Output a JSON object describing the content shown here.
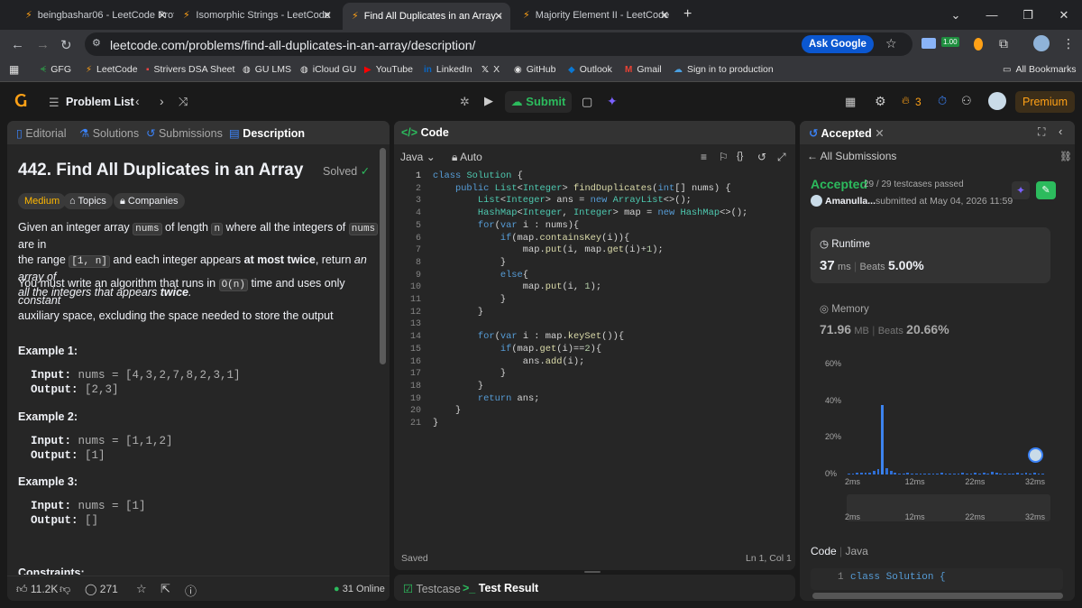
{
  "browser": {
    "tabs": [
      {
        "title": "beingbashar06 - LeetCode Profi",
        "active": false
      },
      {
        "title": "Isomorphic Strings - LeetCode",
        "active": false
      },
      {
        "title": "Find All Duplicates in an Array -",
        "active": true
      },
      {
        "title": "Majority Element II - LeetCode",
        "active": false
      }
    ],
    "url": "leetcode.com/problems/find-all-duplicates-in-an-array/description/",
    "ask_google": "Ask Google",
    "extension_badge": "1.00",
    "bookmarks": [
      "GFG",
      "LeetCode",
      "Strivers DSA Sheet",
      "GU LMS",
      "iCloud GU",
      "YouTube",
      "LinkedIn",
      "X",
      "GitHub",
      "Outlook",
      "Gmail",
      "Sign in to production"
    ],
    "all_bookmarks": "All Bookmarks"
  },
  "nav": {
    "problem_list": "Problem List",
    "submit": "Submit",
    "streak": "3",
    "premium": "Premium"
  },
  "left": {
    "tabs": [
      "Editorial",
      "Solutions",
      "Submissions",
      "Description"
    ],
    "title": "442. Find All Duplicates in an Array",
    "solved": "Solved",
    "difficulty": "Medium",
    "topics": "Topics",
    "companies": "Companies",
    "desc": {
      "p1_a": "Given an integer array ",
      "p1_code1": "nums",
      "p1_b": " of length ",
      "p1_code2": "n",
      "p1_c": " where all the integers of ",
      "p1_code3": "nums",
      "p1_d": " are in",
      "p1_e": "the range ",
      "p1_code4": "[1, n]",
      "p1_f": " and each integer appears ",
      "p1_bold1": "at most twice",
      "p1_g": ", return ",
      "p1_it1": "an array of",
      "p1_it2": "all the integers that appears ",
      "p1_bolditalic": "twice",
      "p1_h": ".",
      "p2_a": "You must write an algorithm that runs in ",
      "p2_code": "O(n)",
      "p2_b": " time and uses only ",
      "p2_it": "constant",
      "p2_c": "auxiliary space, excluding the space needed to store the output"
    },
    "examples": [
      {
        "title": "Example 1:",
        "input": "nums = [4,3,2,7,8,2,3,1]",
        "output": "[2,3]"
      },
      {
        "title": "Example 2:",
        "input": "nums = [1,1,2]",
        "output": "[1]"
      },
      {
        "title": "Example 3:",
        "input": "nums = [1]",
        "output": "[]"
      }
    ],
    "input_label": "Input:",
    "output_label": "Output:",
    "constraints": "Constraints:",
    "likes": "11.2K",
    "comments": "271",
    "online": "31 Online"
  },
  "code": {
    "header": "Code",
    "language": "Java",
    "auto": "Auto",
    "saved": "Saved",
    "cursor": "Ln 1, Col 1",
    "lines": [
      "class Solution {",
      "    public List<Integer> findDuplicates(int[] nums) {",
      "        List<Integer> ans = new ArrayList<>();",
      "        HashMap<Integer, Integer> map = new HashMap<>();",
      "        for(var i : nums){",
      "            if(map.containsKey(i)){",
      "                map.put(i, map.get(i)+1);",
      "            }",
      "            else{",
      "                map.put(i, 1);",
      "            }",
      "        }",
      "",
      "        for(var i : map.keySet()){",
      "            if(map.get(i)==2){",
      "                ans.add(i);",
      "            }",
      "        }",
      "        return ans;",
      "    }",
      "}"
    ],
    "bottom_tabs": [
      "Testcase",
      "Test Result"
    ]
  },
  "result": {
    "tab": "Accepted",
    "all_submissions": "All Submissions",
    "status": "Accepted",
    "testcases": "29 / 29 testcases passed",
    "user": "Amanulla...",
    "submitted": "submitted at May 04, 2026 11:59",
    "runtime_label": "Runtime",
    "runtime_value": "37",
    "runtime_unit": "ms",
    "beats_label": "Beats",
    "runtime_beats": "5.00%",
    "memory_label": "Memory",
    "memory_value": "71.96",
    "memory_unit": "MB",
    "memory_beats": "20.66%",
    "code_label": "Code",
    "code_lang": "Java",
    "code_preview": "class Solution {"
  },
  "chart_data": {
    "type": "bar",
    "yticks": [
      "60%",
      "40%",
      "20%",
      "0%"
    ],
    "xticks": [
      "2ms",
      "12ms",
      "22ms",
      "32ms"
    ],
    "ylim": [
      0,
      60
    ],
    "values": [
      0.6,
      0.6,
      0.8,
      0.8,
      1.0,
      1.2,
      2.0,
      3.0,
      38.0,
      3.5,
      1.8,
      1.0,
      0.6,
      0.6,
      0.8,
      0.6,
      0.6,
      0.6,
      0.6,
      0.6,
      0.6,
      0.6,
      0.8,
      0.6,
      0.6,
      0.6,
      0.6,
      1.0,
      0.6,
      0.6,
      1.2,
      0.6,
      1.0,
      0.6,
      1.4,
      0.8,
      0.6,
      0.6,
      0.6,
      0.6,
      0.8,
      0.6,
      1.0,
      0.6,
      0.8,
      0.6,
      0.6
    ]
  }
}
